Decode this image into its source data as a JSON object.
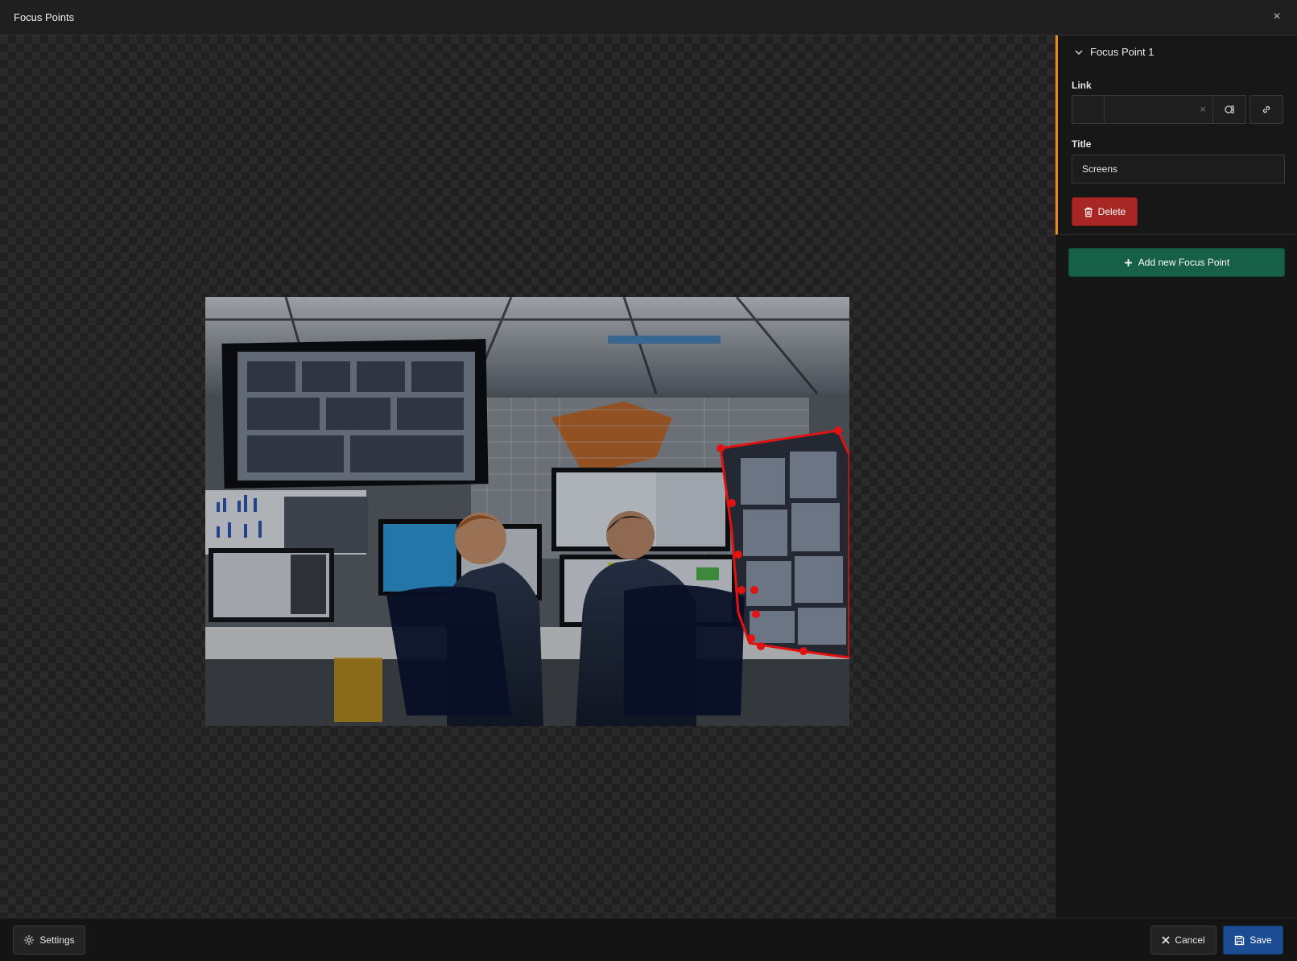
{
  "window": {
    "title": "Focus Points",
    "close_label": "×"
  },
  "colors": {
    "accent": "#e8891b",
    "delete": "#a82623",
    "add": "#176048",
    "save": "#1c4c94",
    "focus_outline": "#e01212"
  },
  "focus_point": {
    "heading": "Focus Point 1",
    "link_label": "Link",
    "link_value": "",
    "link_clear": "×",
    "title_label": "Title",
    "title_value": "Screens",
    "delete_label": "Delete"
  },
  "add_button_label": "Add new Focus Point",
  "footer": {
    "settings_label": "Settings",
    "cancel_label": "Cancel",
    "save_label": "Save"
  },
  "icons": [
    "close-icon",
    "chevron-down-icon",
    "clear-icon",
    "link-browser-icon",
    "link-icon",
    "trash-icon",
    "plus-icon",
    "gear-icon",
    "x-icon",
    "floppy-icon"
  ]
}
